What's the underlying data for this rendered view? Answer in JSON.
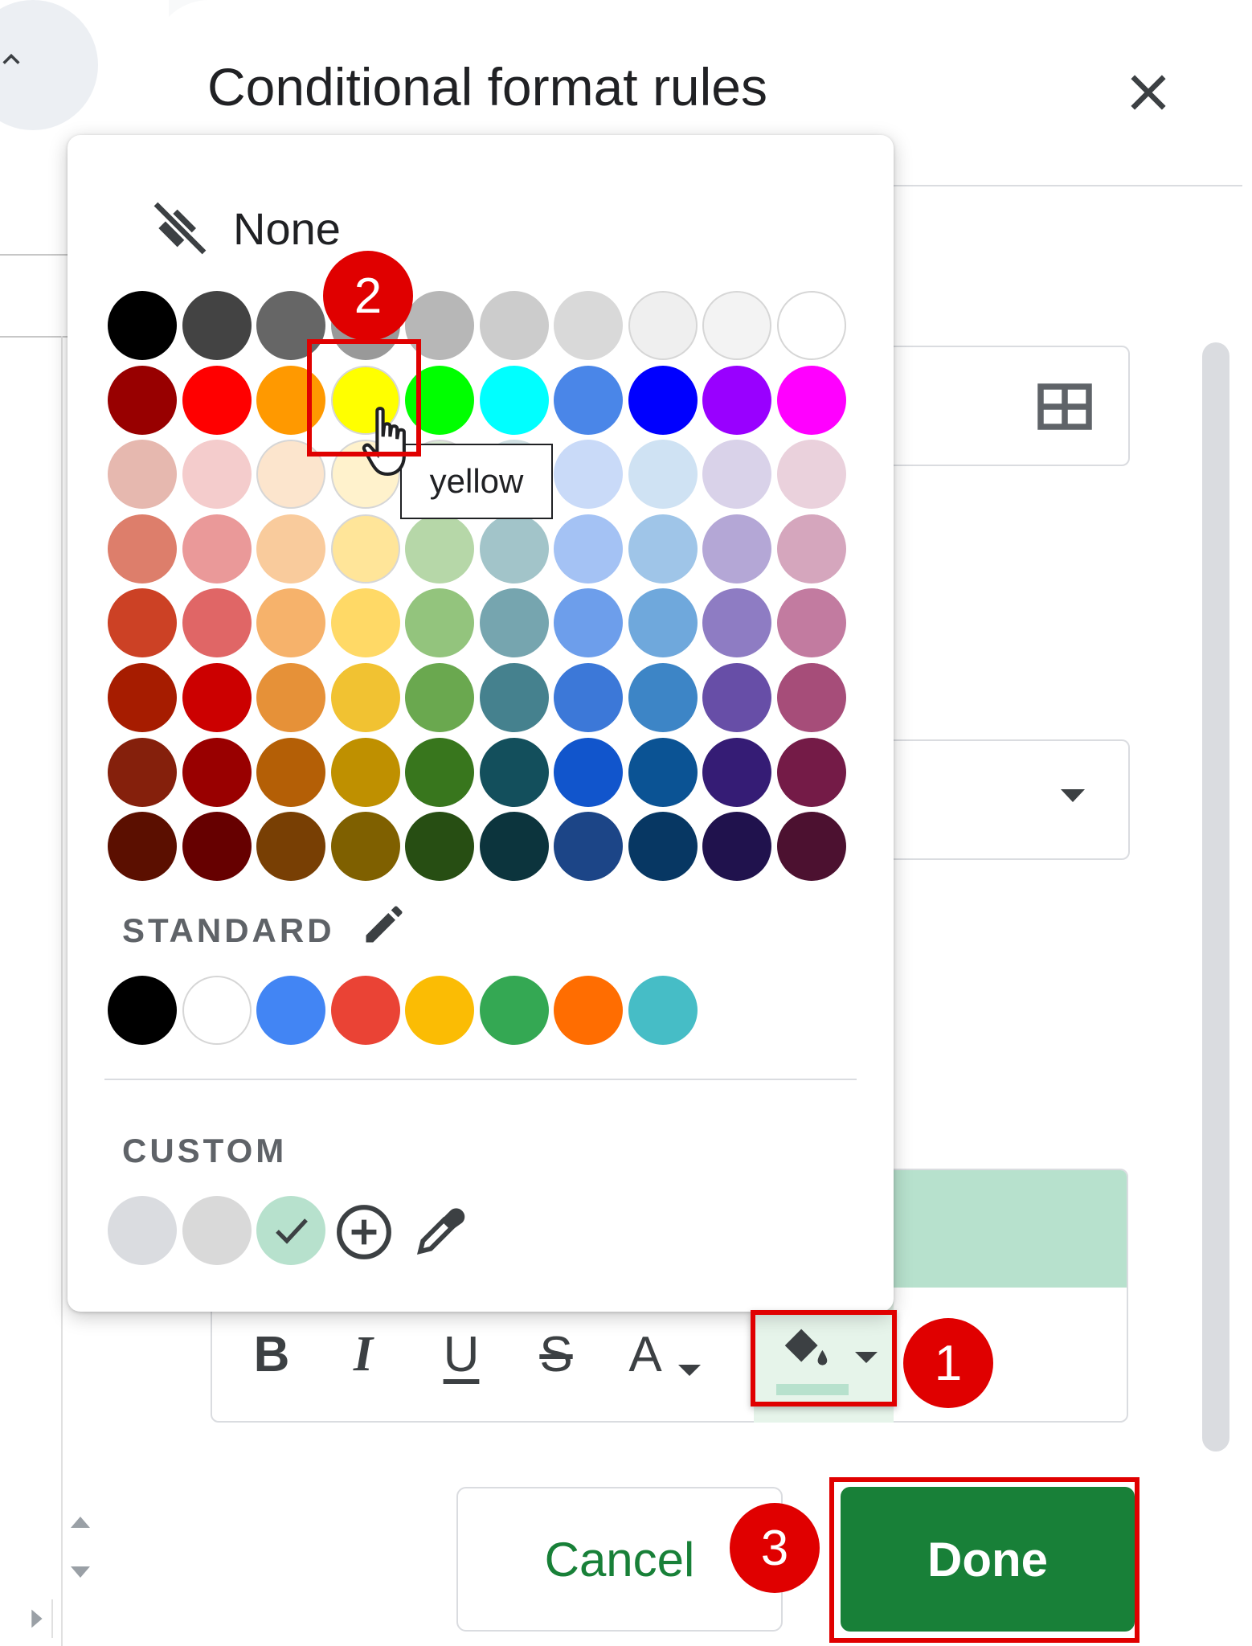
{
  "panel": {
    "title": "Conditional format rules",
    "close_icon": "close-icon"
  },
  "color_picker": {
    "none_label": "None",
    "none_icon": "no-fill-icon",
    "tooltip": "yellow",
    "palette": [
      [
        "#000000",
        "#434343",
        "#666666",
        "#999999",
        "#b7b7b7",
        "#cccccc",
        "#d9d9d9",
        "#efefef",
        "#f3f3f3",
        "#ffffff"
      ],
      [
        "#980000",
        "#ff0000",
        "#ff9900",
        "#ffff00",
        "#00ff00",
        "#00ffff",
        "#4a86e8",
        "#0000ff",
        "#9900ff",
        "#ff00ff"
      ],
      [
        "#e6b8af",
        "#f4cccc",
        "#fce5cd",
        "#fff2cc",
        "#d9ead3",
        "#d0e0e3",
        "#c9daf8",
        "#cfe2f3",
        "#d9d2e9",
        "#ead1dc"
      ],
      [
        "#dd7e6b",
        "#ea9999",
        "#f9cb9c",
        "#ffe599",
        "#b6d7a8",
        "#a2c4c9",
        "#a4c2f4",
        "#9fc5e8",
        "#b4a7d6",
        "#d5a6bd"
      ],
      [
        "#cc4125",
        "#e06666",
        "#f6b26b",
        "#ffd966",
        "#93c47d",
        "#76a5af",
        "#6d9eeb",
        "#6fa8dc",
        "#8e7cc3",
        "#c27ba0"
      ],
      [
        "#a61c00",
        "#cc0000",
        "#e69138",
        "#f1c232",
        "#6aa84f",
        "#45818e",
        "#3c78d8",
        "#3d85c6",
        "#674ea7",
        "#a64d79"
      ],
      [
        "#85200c",
        "#990000",
        "#b45f06",
        "#bf9000",
        "#38761d",
        "#134f5c",
        "#1155cc",
        "#0b5394",
        "#351c75",
        "#741b47"
      ],
      [
        "#5b0f00",
        "#660000",
        "#783f04",
        "#7f6000",
        "#274e13",
        "#0c343d",
        "#1c4587",
        "#073763",
        "#20124d",
        "#4c1130"
      ]
    ],
    "standard_label": "STANDARD",
    "standard_colors": [
      "#000000",
      "#ffffff",
      "#4285f4",
      "#ea4335",
      "#fbbc04",
      "#34a853",
      "#ff6d01",
      "#46bdc6"
    ],
    "custom_label": "CUSTOM",
    "custom_colors": [
      "#dadce0",
      "#d9d9d9",
      "#b7e1cd"
    ],
    "selected_custom": "#b7e1cd"
  },
  "formatting": {
    "preview_color": "#b7e1cd",
    "bold": "B",
    "italic": "I",
    "underline": "U",
    "strikethrough": "S",
    "text_color": "A"
  },
  "actions": {
    "cancel": "Cancel",
    "done": "Done",
    "accent": "#188038"
  },
  "annotations": {
    "steps": [
      "1",
      "2",
      "3"
    ],
    "color": "#e00000"
  }
}
